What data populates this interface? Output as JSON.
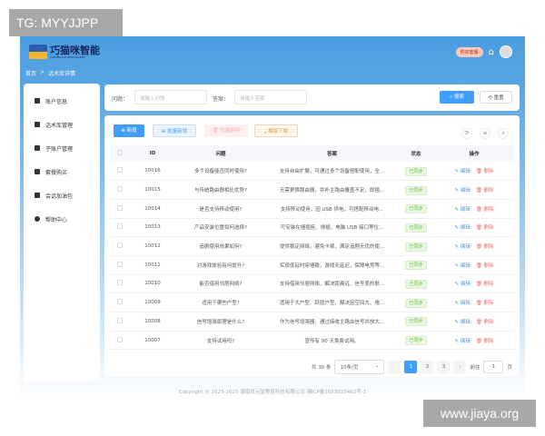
{
  "watermarks": {
    "top_left": "TG: MYYJJPP",
    "bottom_right": "www.jiaya.org"
  },
  "header": {
    "logo_title": "巧猫咪智能",
    "logo_subtitle": "CLEVER CAT INTELLIGENT",
    "buy_label": "购买套餐"
  },
  "breadcrumb": {
    "home": "首页",
    "separator": ">",
    "current": "话术库详情"
  },
  "sidebar": {
    "items": [
      {
        "label": "账户信息"
      },
      {
        "label": "话术库管理"
      },
      {
        "label": "子账户管理"
      },
      {
        "label": "套餐购买"
      },
      {
        "label": "会话加油包"
      },
      {
        "label": "帮助中心"
      }
    ]
  },
  "search": {
    "question_label": "问题：",
    "question_placeholder": "请输入问题",
    "answer_label": "答案：",
    "answer_placeholder": "请输入答案",
    "search_label": "搜索",
    "reset_label": "重置"
  },
  "toolbar": {
    "add": "新增",
    "batch_add": "批量新增",
    "batch_delete": "批量删除",
    "template_download": "模版下载"
  },
  "table": {
    "columns": [
      "ID",
      "问题",
      "答案",
      "状态",
      "操作"
    ],
    "edit_label": "编辑",
    "delete_label": "删除",
    "rows": [
      {
        "id": "10016",
        "q": "多个设备能否同时使用?",
        "a": "支持自由扩展，可通过多个设备搭配使用，全...",
        "status": "已同步"
      },
      {
        "id": "10015",
        "q": "与传统路由器相比优势?",
        "a": "无需更换路由器，弥补主路由覆盖不足，即插...",
        "status": "已同步"
      },
      {
        "id": "10014",
        "q": "是否支持移动使用?",
        "a": "支持移动使用，因 USB 供电，可搭配移动电...",
        "status": "已同步"
      },
      {
        "id": "10013",
        "q": "产品安装位置如何选择?",
        "a": "可安装在墙插座、排插、电脑 USB 接口等位...",
        "status": "已同步"
      },
      {
        "id": "10012",
        "q": "追剧使用效果如何?",
        "a": "提供稳定网络，避免卡顿，满足追剧无忧的使...",
        "status": "已同步"
      },
      {
        "id": "10011",
        "q": "对游戏体验有何提升?",
        "a": "实现低延时穿墙稳，游戏无延迟，保障电竞等...",
        "status": "已同步"
      },
      {
        "id": "10010",
        "q": "能否借用邻居网络?",
        "a": "支持借用邻居网络，解决距离远、信号差的耿...",
        "status": "已同步"
      },
      {
        "id": "10009",
        "q": "适用于哪些户型?",
        "a": "适用于大户型、跃层户型，解决因空间大、墙...",
        "status": "已同步"
      },
      {
        "id": "10008",
        "q": "信号增强原理是什么?",
        "a": "作为信号增强器，通过接收主路由信号并放大...",
        "status": "已同步"
      },
      {
        "id": "10007",
        "q": "支持试用吗?",
        "a": "宣传有 90 天免费试用。",
        "status": "已同步"
      }
    ]
  },
  "pagination": {
    "total": "共 30 条",
    "page_size": "10条/页",
    "pages": [
      "1",
      "2",
      "3"
    ],
    "current": "1",
    "goto_label": "前往",
    "goto_value": "1",
    "page_unit": "页"
  },
  "footer": {
    "copyright": "Copyright © 2023-2025 湖南状元堂教育科技有限公司 湘ICP备2023023462号-1"
  }
}
